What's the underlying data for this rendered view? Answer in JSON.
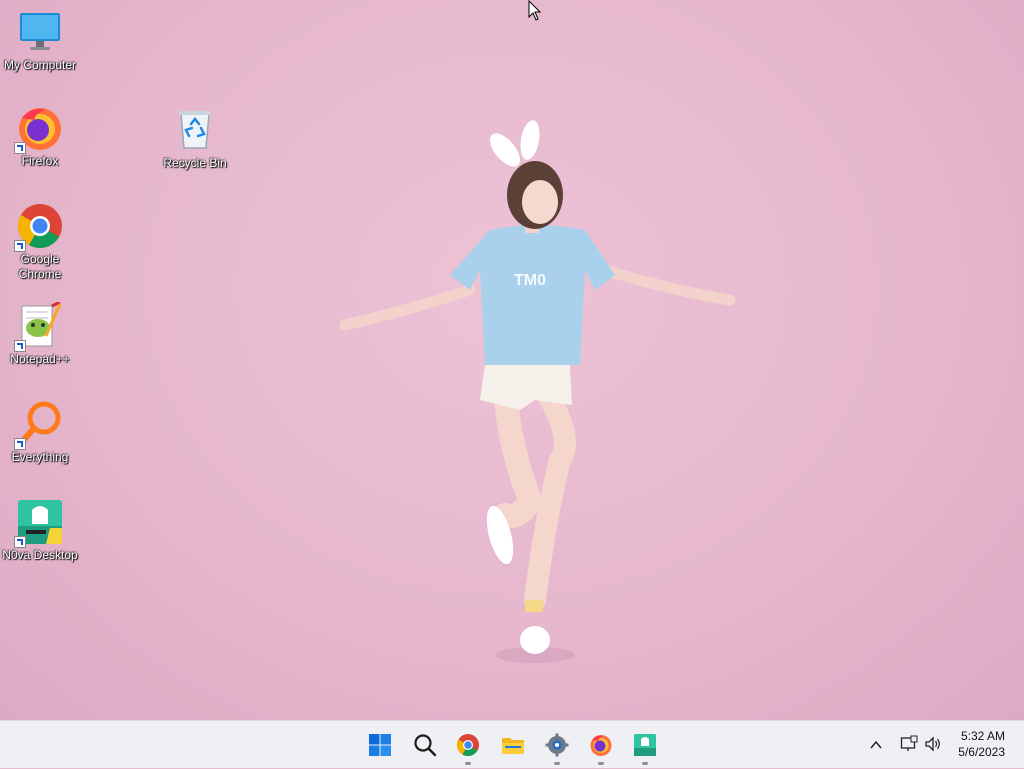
{
  "desktop": {
    "icons": [
      {
        "label": "My Computer",
        "icon": "monitor-icon"
      },
      {
        "label": "Firefox",
        "icon": "firefox-icon"
      },
      {
        "label": "Google\nChrome",
        "icon": "chrome-icon"
      },
      {
        "label": "Notepad++",
        "icon": "notepadpp-icon"
      },
      {
        "label": "Everything",
        "icon": "everything-search-icon"
      },
      {
        "label": "N0va Desktop",
        "icon": "nova-desktop-icon"
      },
      {
        "label": "Recycle Bin",
        "icon": "recycle-bin-icon"
      }
    ],
    "wallpaper_color": "#e6b7cd"
  },
  "taskbar": {
    "apps": [
      "start-icon",
      "search-icon",
      "chrome-icon",
      "file-explorer-icon",
      "settings-icon",
      "firefox-icon",
      "nova-desktop-icon"
    ],
    "tray": {
      "time": "5:32 AM",
      "date": "5/6/2023"
    },
    "accent": "#0a6cd8"
  }
}
